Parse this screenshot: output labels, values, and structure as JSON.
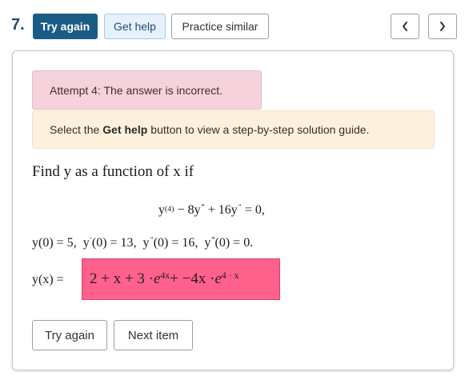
{
  "question": {
    "number": "7.",
    "toolbar": {
      "try_again": "Try again",
      "get_help": "Get help",
      "practice_similar": "Practice similar",
      "prev_symbol": "‹",
      "next_symbol": "›"
    }
  },
  "feedback": {
    "attempt_message": "Attempt 4: The answer is incorrect.",
    "help_prefix": "Select the",
    "help_bold": "Get help",
    "help_suffix": "button to view a step-by-step solution guide."
  },
  "problem": {
    "prompt": "Find y as a function of x if",
    "equation": {
      "y": "y",
      "order4": "(4)",
      "minus": "−",
      "coef8": "8y",
      "triple_prime": "‴",
      "plus": "+",
      "coef16": "16y",
      "double_prime": "″",
      "equals_zero": "= 0,"
    },
    "conditions": {
      "c1": "y(0) = 5,",
      "c2_a": "y",
      "c2_prime": "′",
      "c2_b": "(0) = 13,",
      "c3_a": "y",
      "c3_prime": "″",
      "c3_b": "(0) = 16,",
      "c4_a": "y",
      "c4_prime": "‴",
      "c4_b": "(0) = 0."
    },
    "answer_label": "y(x) =",
    "answer": {
      "p1": "2 + x + 3 · ",
      "e1": "e",
      "e1_exp": "4x",
      "p2": " + −4x · ",
      "e2": "e",
      "e2_exp": "4 · x"
    }
  },
  "footer": {
    "try_again": "Try again",
    "next_item": "Next item"
  },
  "colors": {
    "primary": "#1a5c86",
    "error_bg": "#f6d3dc",
    "info_bg": "#fdf1dd",
    "answer_wrong": "#ff608c"
  }
}
